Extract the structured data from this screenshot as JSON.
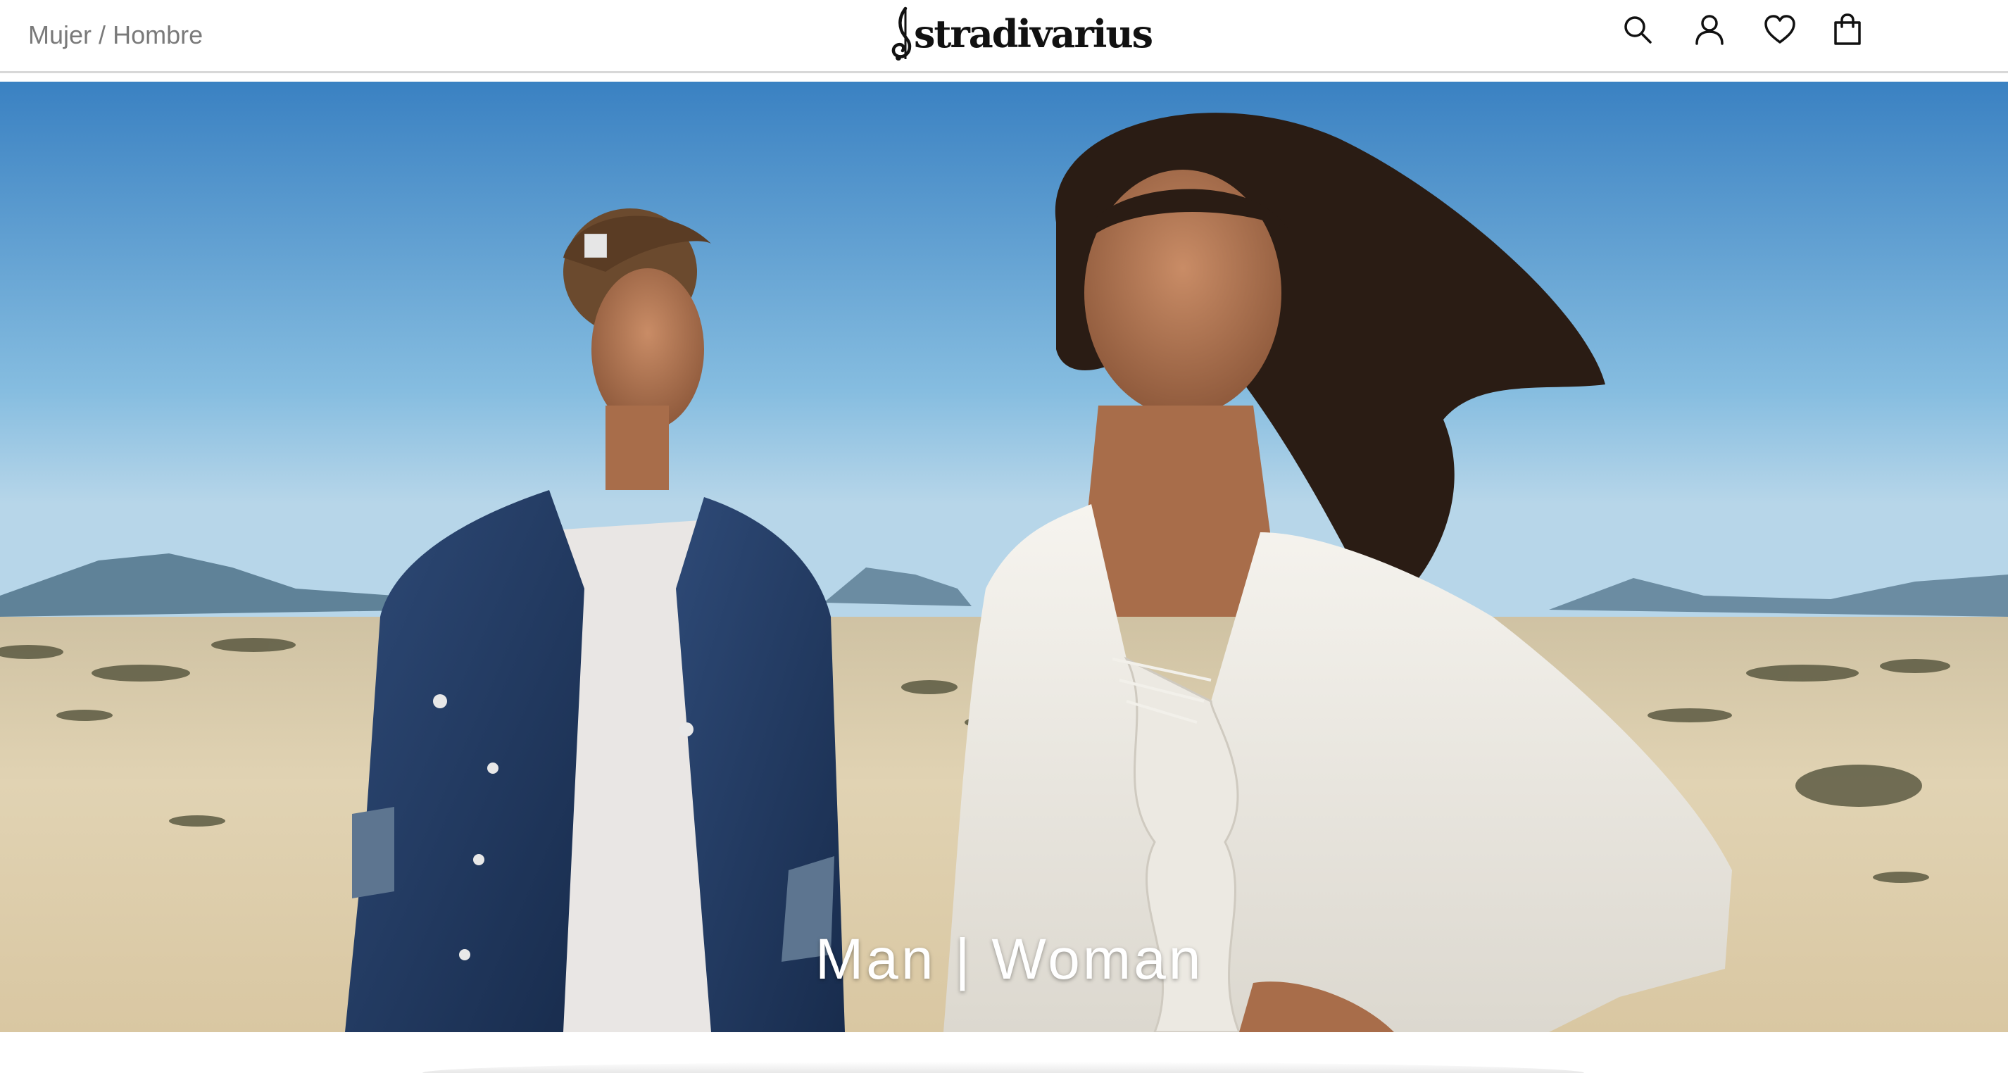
{
  "header": {
    "breadcrumb": {
      "women": "Mujer",
      "separator": "/",
      "men": "Hombre"
    },
    "logo_text": "stradivarius",
    "icons": [
      "search-icon",
      "user-icon",
      "heart-icon",
      "shopping-bag-icon"
    ]
  },
  "hero": {
    "caption": "Man | Woman"
  },
  "colors": {
    "text_primary": "#111111",
    "text_muted": "#7a7a7a",
    "header_border": "#d8d8d8",
    "sky_top": "#3f86c4",
    "sand": "#dccba6",
    "caption": "#ffffff"
  }
}
